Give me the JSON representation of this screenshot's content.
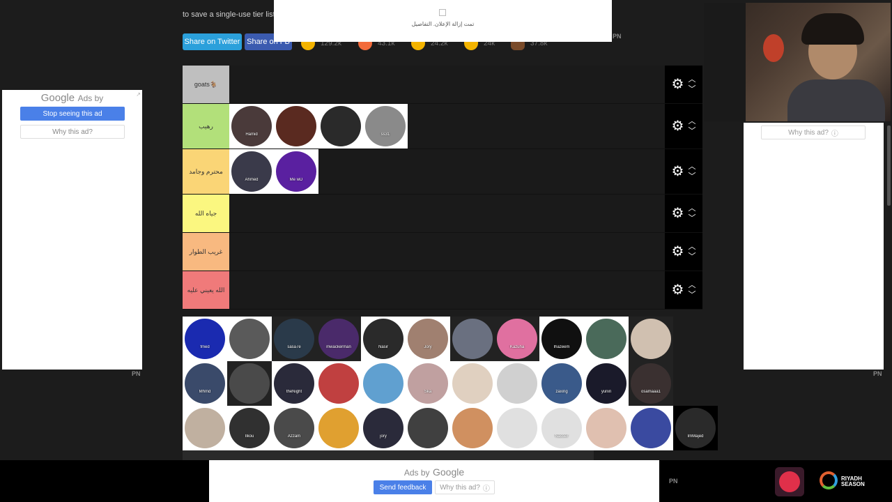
{
  "intro_text": "to save a single-use tier list",
  "share": {
    "twitter": "Share on Twitter",
    "fb": "Share on FB"
  },
  "reactions": [
    {
      "icon": "laughing-emoji-icon",
      "count": "129.2k"
    },
    {
      "icon": "angry-emoji-icon",
      "count": "43.1k"
    },
    {
      "icon": "crying-laughing-emoji-icon",
      "count": "24.2k"
    },
    {
      "icon": "raised-hands-emoji-icon",
      "count": "24k"
    },
    {
      "icon": "poop-emoji-icon",
      "count": "37.8k"
    }
  ],
  "top_ad": {
    "text": "تمت إزالة الإعلان. التفاصيل"
  },
  "pn_label": "PN",
  "tiers": [
    {
      "label": "goats🐐",
      "color": "#bfbfbf",
      "items": []
    },
    {
      "label": "رهيب",
      "color": "#b2e07a",
      "items": [
        {
          "name": "Hamid",
          "color": "#4a3a3a"
        },
        {
          "name": "",
          "color": "#5a2a20"
        },
        {
          "name": "",
          "color": "#2a2a2a"
        },
        {
          "name": "ss31",
          "color": "#8a8a8a"
        }
      ]
    },
    {
      "label": "محترم وجامد",
      "color": "#fad576",
      "items": [
        {
          "name": "Ahmed",
          "color": "#3a3a4a"
        },
        {
          "name": "Me wD",
          "color": "#5a20a0"
        }
      ]
    },
    {
      "label": "جياه الله",
      "color": "#fbf780",
      "items": []
    },
    {
      "label": "غريب الطوار",
      "color": "#f8b980",
      "items": []
    },
    {
      "label": "الله يعيني عليه",
      "color": "#f07a7a",
      "items": []
    }
  ],
  "pool": [
    [
      {
        "name": "fmed",
        "color": "#1a2ab0"
      },
      {
        "name": "",
        "color": "#5a5a5a"
      },
      {
        "name": "sasa7e",
        "color": "#2a3a4a"
      },
      {
        "name": "mwackerman",
        "color": "#4a2a6a"
      },
      {
        "name": "Nasir",
        "color": "#2a2a2a"
      },
      {
        "name": "Jory",
        "color": "#a08070"
      },
      {
        "name": "",
        "color": "#6a7080"
      },
      {
        "name": "Kazuha",
        "color": "#e070a0"
      },
      {
        "name": "Ihazeem",
        "color": "#101010"
      },
      {
        "name": "",
        "color": "#4a6a5a"
      },
      {
        "name": "",
        "color": "#d0c0b0"
      }
    ],
    [
      {
        "name": "Mhmd",
        "color": "#3a4a6a"
      },
      {
        "name": "",
        "color": "#4a4a4a"
      },
      {
        "name": "theNight",
        "color": "#2a2a3a"
      },
      {
        "name": "",
        "color": "#c04040"
      },
      {
        "name": "",
        "color": "#60a0d0"
      },
      {
        "name": "Ska",
        "color": "#c0a0a0"
      },
      {
        "name": "",
        "color": "#e0d0c0"
      },
      {
        "name": "",
        "color": "#d0d0d0"
      },
      {
        "name": "zaxing",
        "color": "#3a5a8a"
      },
      {
        "name": "yunin",
        "color": "#1a1a2a"
      },
      {
        "name": "osamaaa1",
        "color": "#3a3030"
      }
    ],
    [
      {
        "name": "",
        "color": "#c0b0a0"
      },
      {
        "name": "Ilkou",
        "color": "#303030"
      },
      {
        "name": "Azzam",
        "color": "#4a4a4a"
      },
      {
        "name": "",
        "color": "#e0a030"
      },
      {
        "name": "jory",
        "color": "#2a2a3a"
      },
      {
        "name": "",
        "color": "#404040"
      },
      {
        "name": "",
        "color": "#d09060"
      },
      {
        "name": "",
        "color": "#e0e0e0"
      },
      {
        "name": "Nasser",
        "color": "#e0e0e0"
      },
      {
        "name": "",
        "color": "#e0c0b0"
      },
      {
        "name": "",
        "color": "#3a4aa0"
      },
      {
        "name": "ImMajed",
        "color": "#2a2a2a"
      }
    ]
  ],
  "left_ad": {
    "brand": "Google",
    "ads_by": "Ads by",
    "stop": "Stop seeing this ad",
    "why": "Why this ad?"
  },
  "right_ad": {
    "why": "Why this ad?"
  },
  "bottom_ad": {
    "ads_by": "Ads by",
    "brand": "Google",
    "feedback": "Send feedback",
    "why": "Why this ad?"
  },
  "riyadh": "RIYADH SEASON"
}
